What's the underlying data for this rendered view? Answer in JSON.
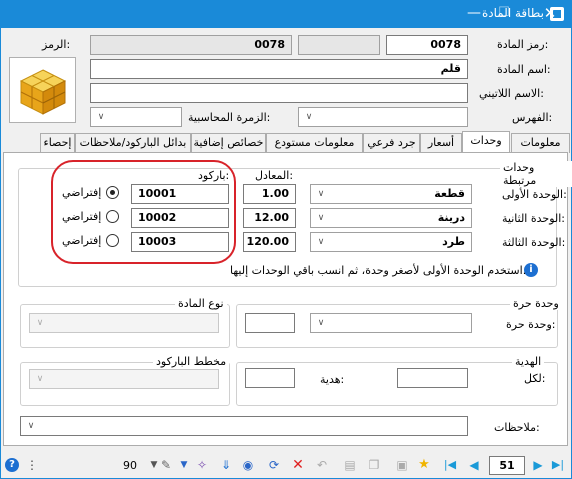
{
  "window": {
    "title": "بطاقة المادة",
    "minimize": "—",
    "maximize": "☐",
    "close": "✕"
  },
  "header": {
    "item_code_label": "رمز المادة:",
    "item_code_value": "0078",
    "code_label": "الرمز:",
    "code_value": "0078",
    "item_name_label": "اسم المادة:",
    "item_name_value": "قلم",
    "latin_name_label": "الاسم اللاتيني:",
    "latin_name_value": "",
    "index_label": "الفهرس:",
    "index_value": "",
    "accounting_group_label": "الزمرة المحاسبية:",
    "accounting_group_value": ""
  },
  "tabs": [
    {
      "label": "معلومات"
    },
    {
      "label": "وحدات"
    },
    {
      "label": "أسعار"
    },
    {
      "label": "جرد فرعي"
    },
    {
      "label": "معلومات مستودع"
    },
    {
      "label": "خصائص إضافية"
    },
    {
      "label": "بدائل الباركود/ملاحظات"
    },
    {
      "label": "إحصاء"
    }
  ],
  "units": {
    "group_title": "وحدات مرتبطة",
    "factor_header": "المعادل:",
    "barcode_header": "باركود:",
    "default_label": "إفتراضي",
    "rows": [
      {
        "label": "الوحدة الأولى:",
        "unit": "قطعة",
        "factor": "1.00",
        "barcode": "10001",
        "default": true
      },
      {
        "label": "الوحدة الثانية:",
        "unit": "درينة",
        "factor": "12.00",
        "barcode": "10002",
        "default": false
      },
      {
        "label": "الوحدة الثالثة:",
        "unit": "طرد",
        "factor": "120.00",
        "barcode": "10003",
        "default": false
      }
    ],
    "info_text": "استخدم الوحدة الأولى لأصغر وحدة، ثم انسب باقي الوحدات إليها."
  },
  "free_unit": {
    "group_title": "وحدة حرة",
    "label": "وحدة حرة:",
    "value": "",
    "factor": ""
  },
  "item_type": {
    "group_title": "نوع المادة",
    "value": ""
  },
  "gift": {
    "group_title": "الهدية",
    "per_label": "لكل:",
    "per_value": "",
    "gift_label": "هدية:",
    "gift_value": ""
  },
  "barcode_scheme": {
    "group_title": "مخطط الباركود",
    "value": ""
  },
  "notes": {
    "label": "ملاحظات:",
    "value": ""
  },
  "statusbar": {
    "zoom": "90",
    "record_number": "51"
  },
  "colors": {
    "titlebar": "#1a8ad8",
    "highlight": "#d8232a",
    "nav_arrows": "#1a9ad8"
  }
}
